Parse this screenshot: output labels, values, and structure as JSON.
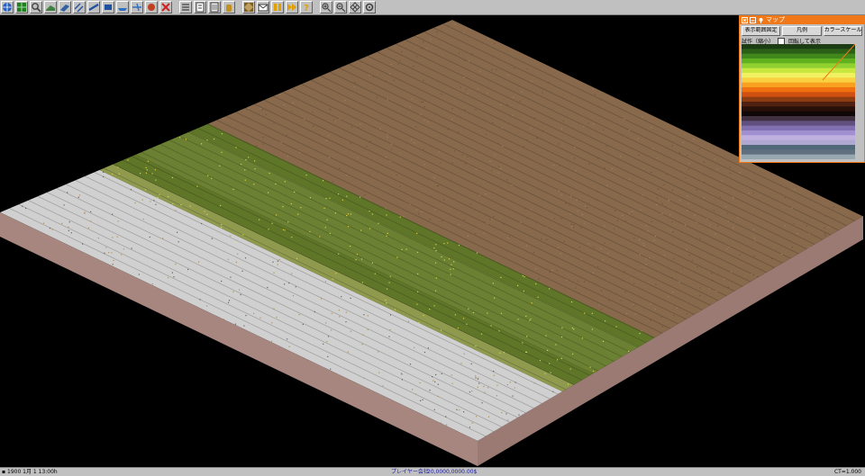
{
  "toolbar": {
    "groups": [
      [
        {
          "name": "main-menu-tool",
          "icon": "globe-icon",
          "color": "#2860c0"
        },
        {
          "name": "map-tool",
          "icon": "map-grid-icon",
          "color": "#208020"
        },
        {
          "name": "inspect-tool",
          "icon": "magnifier-icon",
          "color": "#404040"
        },
        {
          "name": "slope-tool",
          "icon": "slope-icon",
          "color": "#408040"
        },
        {
          "name": "road-tool",
          "icon": "road-icon",
          "color": "#3060a0"
        },
        {
          "name": "rail-tool",
          "icon": "rail-icon",
          "color": "#2050a0"
        },
        {
          "name": "monorail-tool",
          "icon": "monorail-icon",
          "color": "#2050a0"
        },
        {
          "name": "tram-tool",
          "icon": "tram-icon",
          "color": "#2050a0"
        },
        {
          "name": "ship-tool",
          "icon": "ship-icon",
          "color": "#3070c0"
        },
        {
          "name": "air-tool",
          "icon": "plane-icon",
          "color": "#3070c0"
        },
        {
          "name": "special-tool",
          "icon": "signal-icon",
          "color": "#c04020"
        },
        {
          "name": "remove-tool",
          "icon": "cross-icon",
          "color": "#d02020"
        }
      ],
      [
        {
          "name": "line-management-tool",
          "icon": "list-icon",
          "color": "#404040"
        },
        {
          "name": "finance-tool",
          "icon": "ledger-icon",
          "color": "#404040"
        },
        {
          "name": "convoy-list-tool",
          "icon": "document-icon",
          "color": "#404040"
        },
        {
          "name": "player-tool",
          "icon": "hand-icon",
          "color": "#c09020"
        }
      ],
      [
        {
          "name": "minimap-tool",
          "icon": "minimap-icon",
          "color": "#806020"
        },
        {
          "name": "messages-tool",
          "icon": "envelope-icon",
          "color": "#404040"
        },
        {
          "name": "pause-tool",
          "icon": "pause-icon",
          "color": "#e0a000"
        },
        {
          "name": "fastforward-tool",
          "icon": "fastforward-icon",
          "color": "#e0a000"
        },
        {
          "name": "help-tool",
          "icon": "question-icon",
          "color": "#e0a000"
        }
      ],
      [
        {
          "name": "zoom-in-tool",
          "icon": "zoom-in-icon",
          "color": "#404040"
        },
        {
          "name": "zoom-out-tool",
          "icon": "zoom-out-icon",
          "color": "#404040"
        },
        {
          "name": "grid-tool",
          "icon": "grid-icon",
          "color": "#404040"
        },
        {
          "name": "settings-tool",
          "icon": "gear-icon",
          "color": "#404040"
        }
      ]
    ]
  },
  "terrain": {
    "colors": {
      "desert": "#88694c",
      "desert_top": "#8c6c4f",
      "grass": "#6b8032",
      "grass_dark": "#5f7629",
      "grass_light": "#8f9a4e",
      "snow": "#d0d0d0",
      "cliff_left": "#a88680",
      "cliff_right": "#9c7a74"
    }
  },
  "minimap": {
    "title": "マップ",
    "title_icons": [
      "close-icon",
      "minimize-icon",
      "pin-icon"
    ],
    "buttons": [
      "表示範囲固定",
      "凡例",
      "カラースケール"
    ],
    "option_label": "回転して表示",
    "legend_label": "試作（縮小）"
  },
  "status": {
    "date": "1900 1月 1 13:00h",
    "company": "プレイヤー会社",
    "money": "20,0000,0000.00$",
    "zoom": "CT=1.000"
  }
}
